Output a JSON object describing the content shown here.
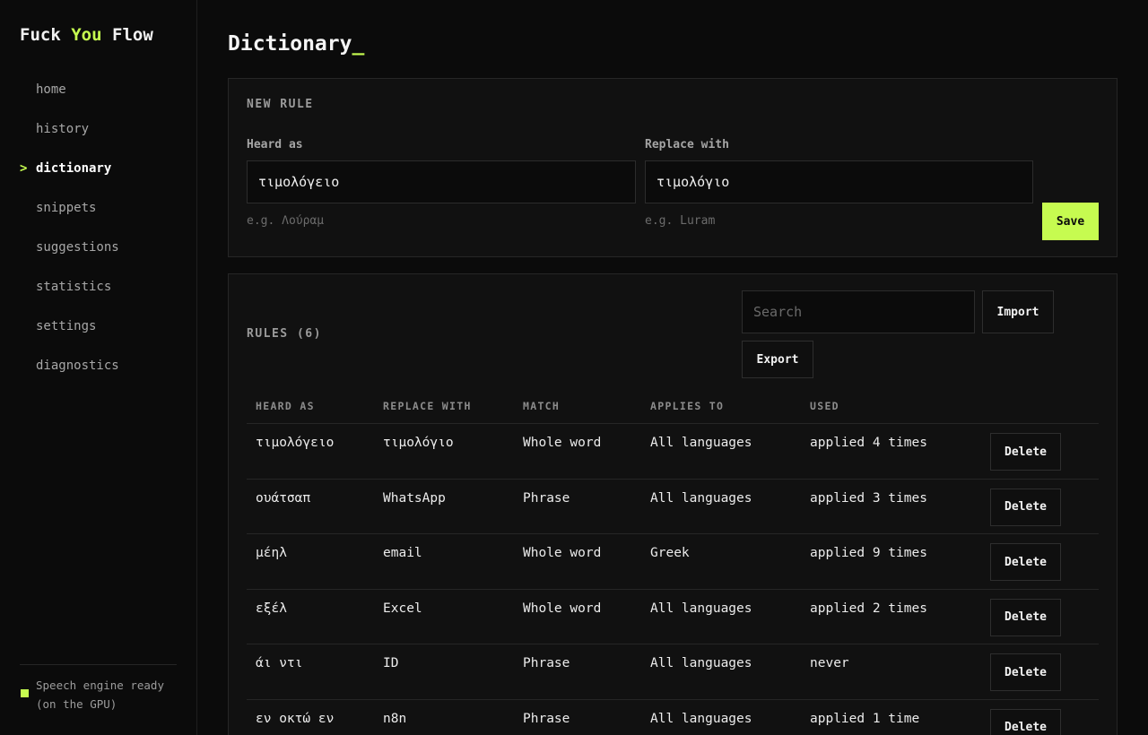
{
  "brand": {
    "part1": "Fuck",
    "part2": "You",
    "part3": "Flow"
  },
  "nav": [
    {
      "label": "home",
      "active": false
    },
    {
      "label": "history",
      "active": false
    },
    {
      "label": "dictionary",
      "active": true
    },
    {
      "label": "snippets",
      "active": false
    },
    {
      "label": "suggestions",
      "active": false
    },
    {
      "label": "statistics",
      "active": false
    },
    {
      "label": "settings",
      "active": false
    },
    {
      "label": "diagnostics",
      "active": false
    }
  ],
  "nav_active_marker": ">",
  "status": {
    "line1": "Speech engine ready",
    "line2": "(on the GPU)",
    "color": "#c6fb50"
  },
  "page": {
    "title": "Dictionary",
    "cursor": "_"
  },
  "new_rule": {
    "section_label": "NEW RULE",
    "heard_label": "Heard as",
    "heard_value": "τιμολόγειο",
    "heard_hint": "e.g. Λούραμ",
    "replace_label": "Replace with",
    "replace_value": "τιμολόγιο",
    "replace_hint": "e.g. Luram",
    "save_label": "Save"
  },
  "rules": {
    "section_label": "RULES (6)",
    "search_placeholder": "Search",
    "import_label": "Import",
    "export_label": "Export",
    "columns": [
      "HEARD AS",
      "REPLACE WITH",
      "MATCH",
      "APPLIES TO",
      "USED"
    ],
    "delete_label": "Delete",
    "rows": [
      {
        "heard": "τιμολόγειο",
        "replace": "τιμολόγιο",
        "match": "Whole word",
        "applies": "All languages",
        "used": "applied 4 times"
      },
      {
        "heard": "ουάτσαπ",
        "replace": "WhatsApp",
        "match": "Phrase",
        "applies": "All languages",
        "used": "applied 3 times"
      },
      {
        "heard": "μέηλ",
        "replace": "email",
        "match": "Whole word",
        "applies": "Greek",
        "used": "applied 9 times"
      },
      {
        "heard": "εξέλ",
        "replace": "Excel",
        "match": "Whole word",
        "applies": "All languages",
        "used": "applied 2 times"
      },
      {
        "heard": "άι ντι",
        "replace": "ID",
        "match": "Phrase",
        "applies": "All languages",
        "used": "never"
      },
      {
        "heard": "εν οκτώ εν",
        "replace": "n8n",
        "match": "Phrase",
        "applies": "All languages",
        "used": "applied 1 time"
      }
    ]
  },
  "colors": {
    "accent": "#c6fb50",
    "background": "#0b0b0b",
    "panel": "#111111"
  }
}
